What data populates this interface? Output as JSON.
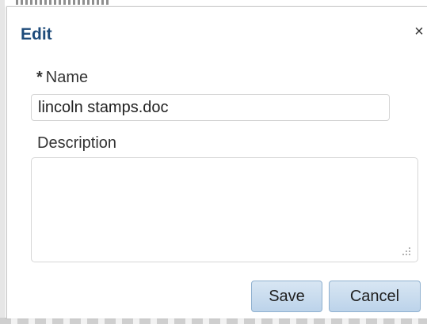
{
  "dialog": {
    "title": "Edit",
    "close_glyph": "×",
    "close_icon": "close-icon"
  },
  "form": {
    "name_required_marker": "*",
    "name_label": "Name",
    "name_value": "lincoln stamps.doc",
    "description_label": "Description",
    "description_value": ""
  },
  "buttons": {
    "save_label": "Save",
    "cancel_label": "Cancel"
  },
  "colors": {
    "title": "#1e4b7a",
    "button_bg": "#bcd3ea",
    "button_border": "#8fb0cf"
  }
}
